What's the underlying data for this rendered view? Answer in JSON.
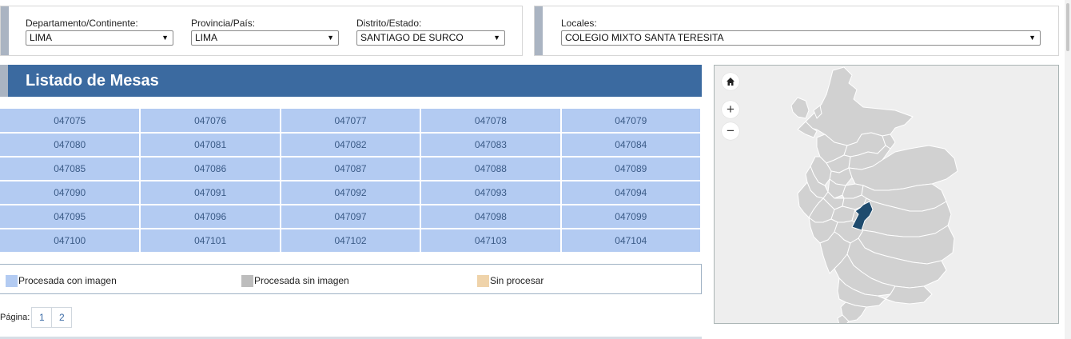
{
  "filters": {
    "departamento": {
      "label": "Departamento/Continente:",
      "value": "LIMA"
    },
    "provincia": {
      "label": "Provincia/País:",
      "value": "LIMA"
    },
    "distrito": {
      "label": "Distrito/Estado:",
      "value": "SANTIAGO DE SURCO"
    },
    "locales": {
      "label": "Locales:",
      "value": "COLEGIO MIXTO SANTA TERESITA"
    }
  },
  "mesas": {
    "title": "Listado de Mesas",
    "rows": [
      [
        "047075",
        "047076",
        "047077",
        "047078",
        "047079"
      ],
      [
        "047080",
        "047081",
        "047082",
        "047083",
        "047084"
      ],
      [
        "047085",
        "047086",
        "047087",
        "047088",
        "047089"
      ],
      [
        "047090",
        "047091",
        "047092",
        "047093",
        "047094"
      ],
      [
        "047095",
        "047096",
        "047097",
        "047098",
        "047099"
      ],
      [
        "047100",
        "047101",
        "047102",
        "047103",
        "047104"
      ]
    ]
  },
  "legend": {
    "items": [
      {
        "label": "Procesada con imagen",
        "color": "#b3cbf2"
      },
      {
        "label": "Procesada sin imagen",
        "color": "#bdbdbd"
      },
      {
        "label": "Sin procesar",
        "color": "#efd3aa"
      }
    ]
  },
  "pager": {
    "label": "Página:",
    "pages": [
      "1",
      "2"
    ]
  },
  "map": {
    "controls": {
      "home_icon": "home-icon",
      "zoom_in": "+",
      "zoom_out": "−"
    },
    "region_fill": "#d1d1d1",
    "selected_fill": "#1e4b6e"
  }
}
